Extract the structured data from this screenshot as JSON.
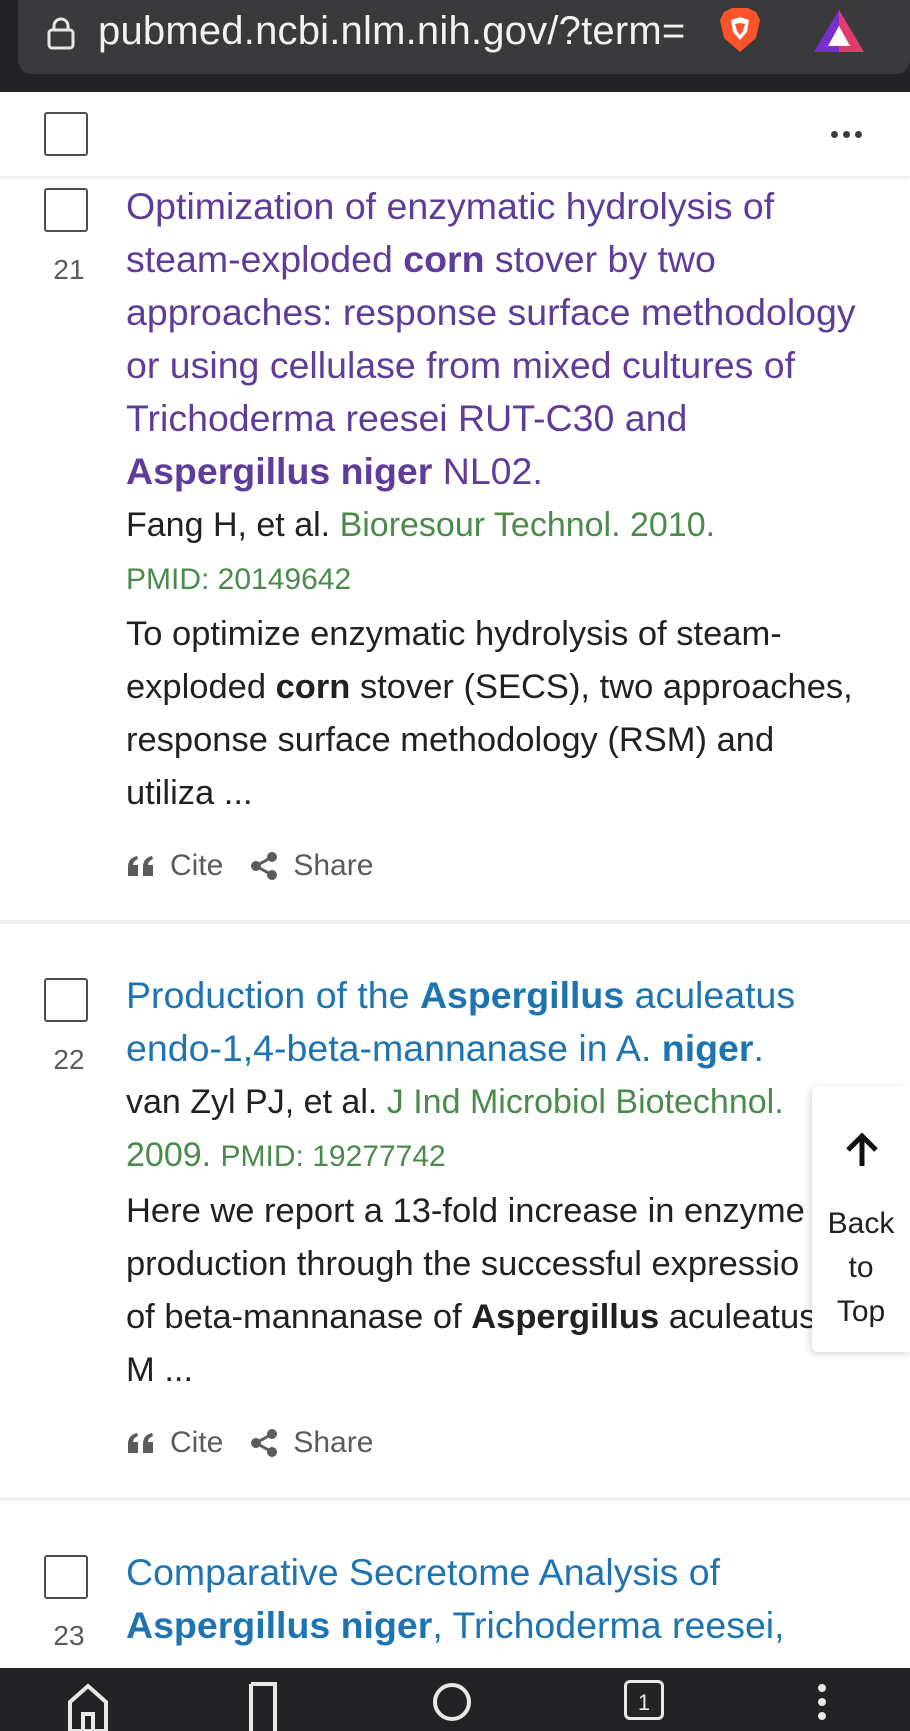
{
  "browser": {
    "url": "pubmed.ncbi.nlm.nih.gov/?term=",
    "tab_count": "1"
  },
  "toolbar": {
    "icons": [
      "lock-icon",
      "brave-shield-icon",
      "brave-rewards-icon",
      "more-options-icon"
    ]
  },
  "results": [
    {
      "number": "21",
      "title_parts": [
        {
          "t": "Optimization of enzymatic hydrolysis of steam-exploded ",
          "b": false
        },
        {
          "t": "corn",
          "b": true
        },
        {
          "t": " stover by two approaches: response surface methodology or using cellulase from mixed cultures of Trichoderma reesei RUT-C30 and ",
          "b": false
        },
        {
          "t": "Aspergillus niger",
          "b": true
        },
        {
          "t": " NL02.",
          "b": false
        }
      ],
      "authors": "Fang H, et al.",
      "journal": "Bioresour Technol. 2010.",
      "pmid": "PMID: 20149642",
      "snippet_parts": [
        {
          "t": "To optimize enzymatic hydrolysis of steam-exploded ",
          "b": false
        },
        {
          "t": "corn",
          "b": true
        },
        {
          "t": " stover (SECS), two approaches, response surface methodology (RSM) and utiliza ...",
          "b": false
        }
      ],
      "visited": true
    },
    {
      "number": "22",
      "title_parts": [
        {
          "t": "Production of the ",
          "b": false
        },
        {
          "t": "Aspergillus",
          "b": true
        },
        {
          "t": " aculeatus endo-1,4-beta-mannanase in A. ",
          "b": false
        },
        {
          "t": "niger",
          "b": true
        },
        {
          "t": ".",
          "b": false
        }
      ],
      "authors": "van Zyl PJ, et al.",
      "journal": "J Ind Microbiol Biotechnol. 2009.",
      "pmid": "PMID: 19277742",
      "snippet_parts": [
        {
          "t": "Here we report a 13-fold increase in enzyme production through the successful expressio of beta-mannanase of ",
          "b": false
        },
        {
          "t": "Aspergillus",
          "b": true
        },
        {
          "t": " aculeatus M ...",
          "b": false
        }
      ],
      "visited": false
    },
    {
      "number": "23",
      "title_parts": [
        {
          "t": "Comparative Secretome Analysis of ",
          "b": false
        },
        {
          "t": "Aspergillus niger",
          "b": true
        },
        {
          "t": ", Trichoderma reesei,",
          "b": false
        }
      ],
      "visited": false
    }
  ],
  "actions": {
    "cite_label": "Cite",
    "share_label": "Share"
  },
  "back_to_top": {
    "line1": "Back",
    "line2": "to",
    "line3": "Top"
  },
  "colors": {
    "visited_link": "#5e3c99",
    "link": "#1d74b0",
    "journal_green": "#4a8a4a",
    "chrome_dark": "#232326"
  }
}
